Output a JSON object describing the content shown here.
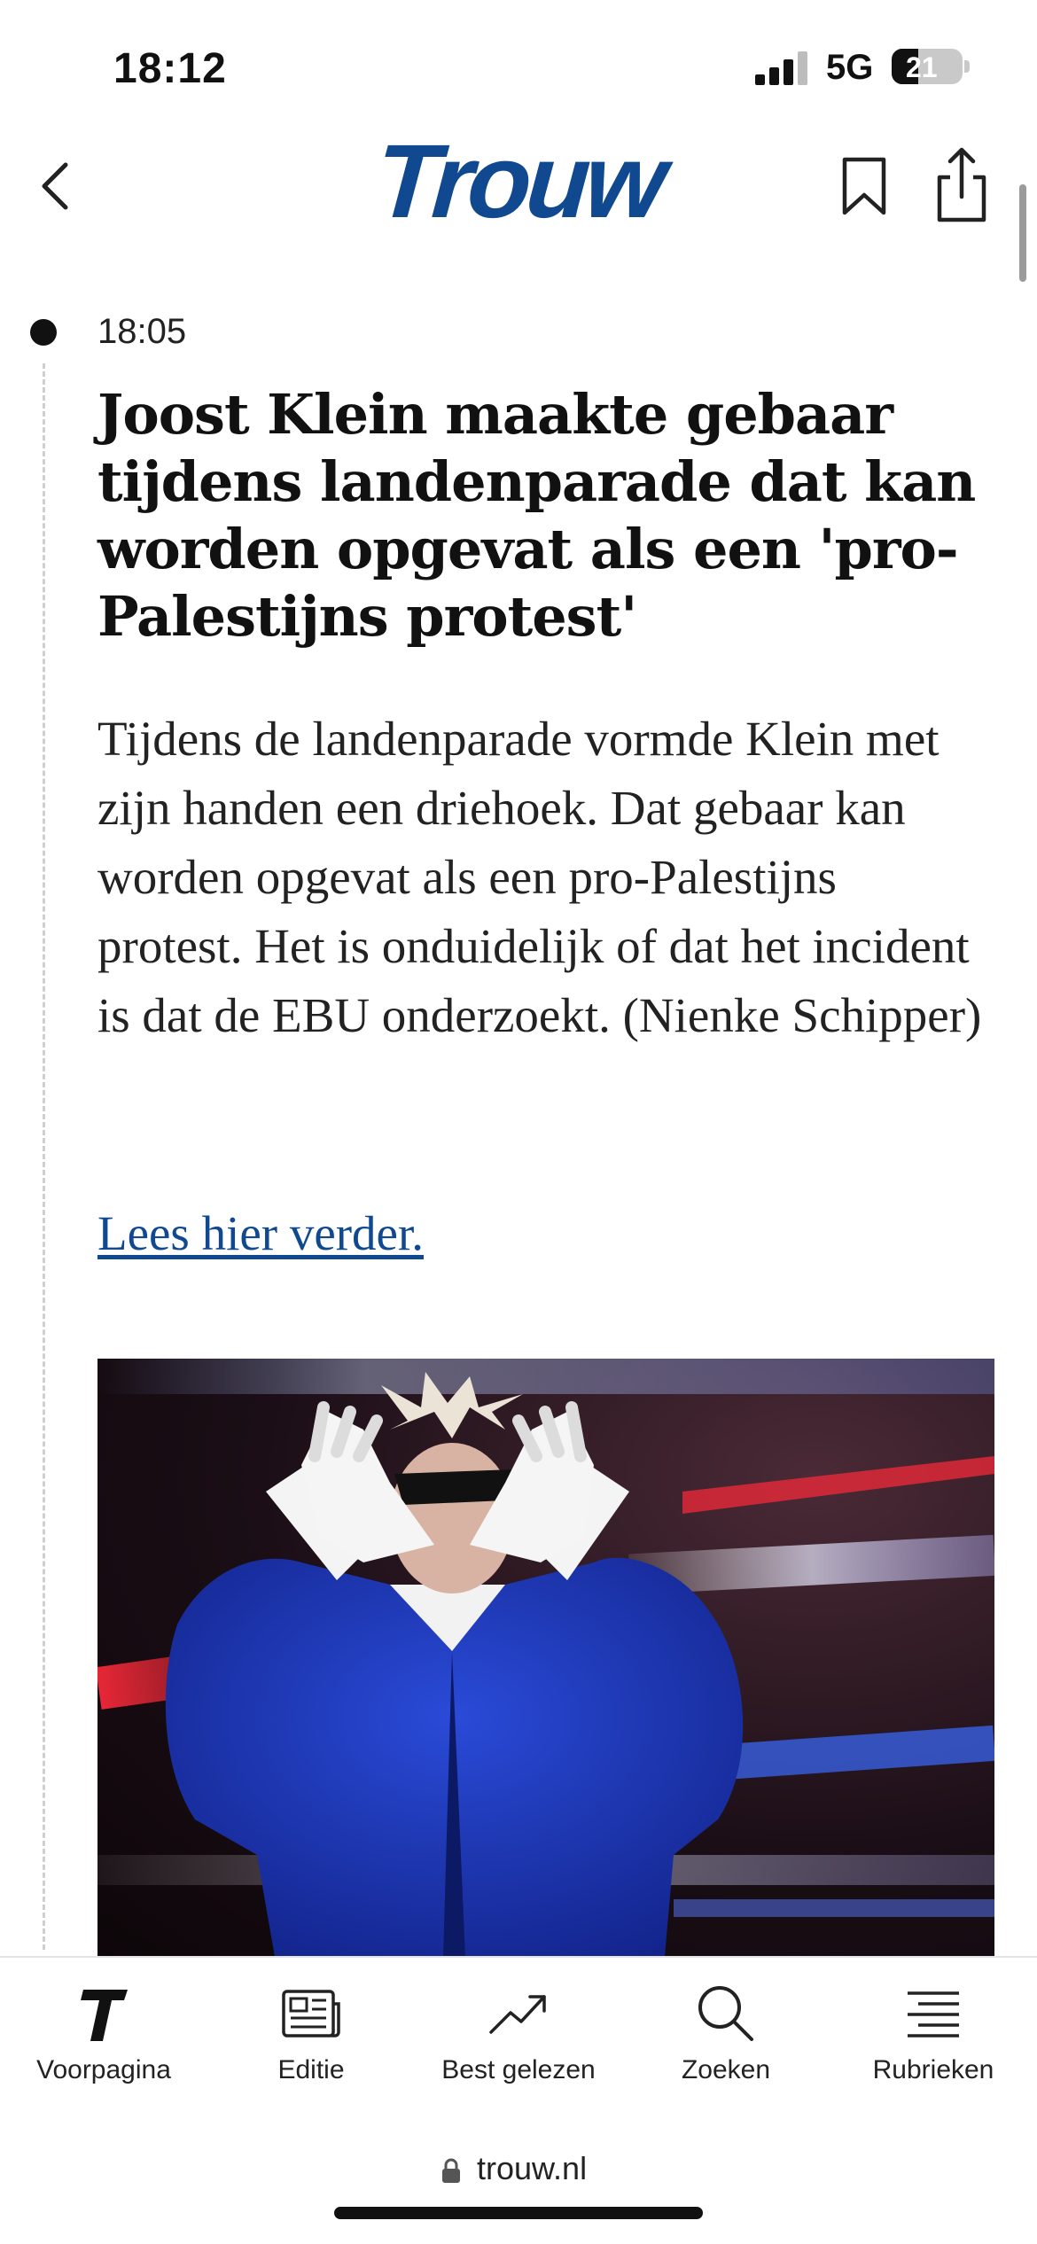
{
  "status_bar": {
    "time": "18:12",
    "network": "5G",
    "battery": "21"
  },
  "header": {
    "logo": "Trouw"
  },
  "post": {
    "time": "18:05",
    "headline": "Joost Klein maakte gebaar tijdens landenparade dat kan worden opgevat als een 'pro-Palestijns protest'",
    "body": "Tijdens de landenparade vormde Klein met zijn handen een driehoek. Dat gebaar kan worden opgevat als een pro-Palestijns protest. Het is onduidelijk of dat het incident is dat de EBU onderzoekt. (Nienke Schipper)",
    "link_text": "Lees hier verder."
  },
  "tabbar": {
    "items": [
      {
        "label": "Voorpagina",
        "icon": "trouw-t-icon"
      },
      {
        "label": "Editie",
        "icon": "newspaper-icon"
      },
      {
        "label": "Best gelezen",
        "icon": "trending-icon"
      },
      {
        "label": "Zoeken",
        "icon": "search-icon"
      },
      {
        "label": "Rubrieken",
        "icon": "list-icon"
      }
    ]
  },
  "browser": {
    "url": "trouw.nl"
  },
  "colors": {
    "brand": "#10498f",
    "link": "#10498f"
  }
}
